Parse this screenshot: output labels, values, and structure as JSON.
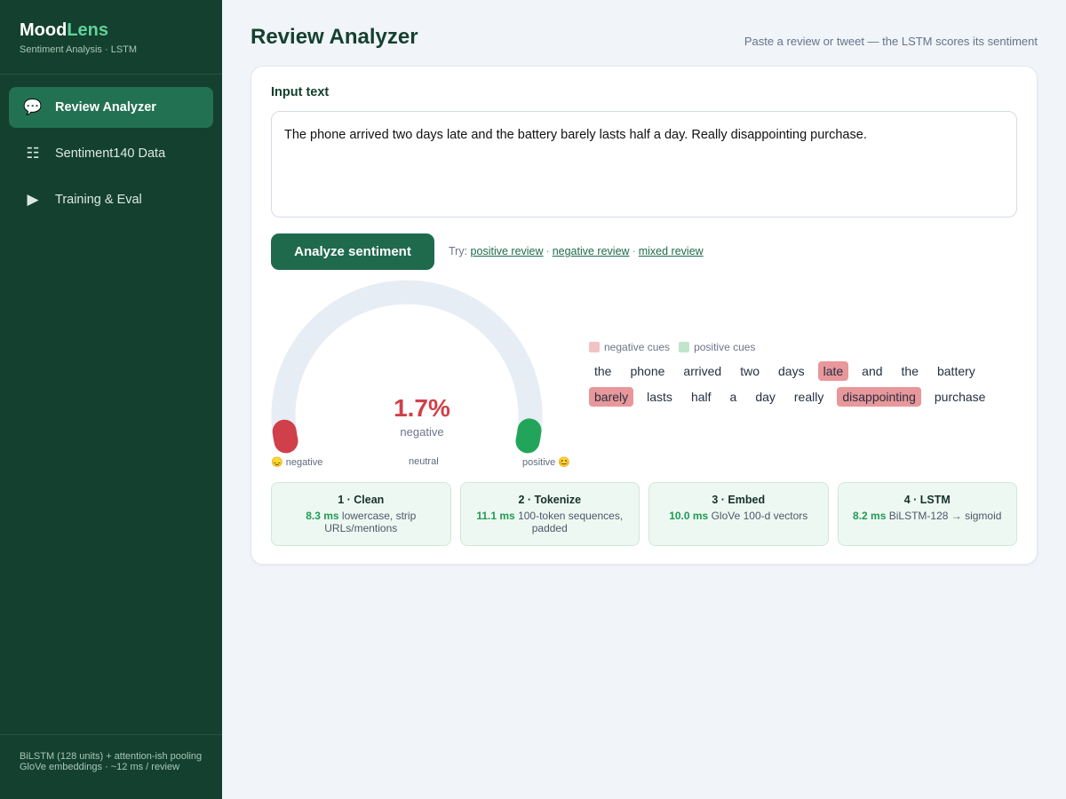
{
  "brand": {
    "title_a": "Mood",
    "title_b": "Lens",
    "subtitle": "Sentiment Analysis · LSTM"
  },
  "nav": [
    {
      "label": "Review Analyzer",
      "icon": "chat-bubble-icon",
      "active": true
    },
    {
      "label": "Sentiment140 Data",
      "icon": "table-list-icon",
      "active": false
    },
    {
      "label": "Training & Eval",
      "icon": "play-icon",
      "active": false
    }
  ],
  "footer": {
    "line1": "BiLSTM (128 units) + attention-ish pooling",
    "line2": "GloVe embeddings · ~12 ms / review"
  },
  "header": {
    "title": "Review Analyzer",
    "hint": "Paste a review or tweet — the LSTM scores its sentiment"
  },
  "input": {
    "label": "Input text",
    "value": "The phone arrived two days late and the battery barely lasts half a day. Really disappointing purchase."
  },
  "actions": {
    "analyze_label": "Analyze sentiment",
    "try_prefix": "Try:",
    "examples": [
      "positive review",
      "negative review",
      "mixed review"
    ]
  },
  "gauge": {
    "value": "1.7%",
    "score": 0.017,
    "label": "negative",
    "min_label": "😞 negative",
    "mid_label": "neutral",
    "max_label": "positive 😊",
    "neg_color": "#d0404a",
    "pos_color": "#22a55a",
    "track_color": "#e7edf4"
  },
  "cues": {
    "neg_label": "negative cues",
    "pos_label": "positive cues",
    "tokens": [
      {
        "text": "the",
        "type": "none"
      },
      {
        "text": "phone",
        "type": "none"
      },
      {
        "text": "arrived",
        "type": "none"
      },
      {
        "text": "two",
        "type": "none"
      },
      {
        "text": "days",
        "type": "none"
      },
      {
        "text": "late",
        "type": "neg"
      },
      {
        "text": "and",
        "type": "none"
      },
      {
        "text": "the",
        "type": "none"
      },
      {
        "text": "battery",
        "type": "none"
      },
      {
        "text": "barely",
        "type": "neg"
      },
      {
        "text": "lasts",
        "type": "none"
      },
      {
        "text": "half",
        "type": "none"
      },
      {
        "text": "a",
        "type": "none"
      },
      {
        "text": "day",
        "type": "none"
      },
      {
        "text": "really",
        "type": "none"
      },
      {
        "text": "disappointing",
        "type": "neg"
      },
      {
        "text": "purchase",
        "type": "none"
      }
    ]
  },
  "pipeline": [
    {
      "title": "1 · Clean",
      "ms": "8.3 ms",
      "desc": "lowercase, strip URLs/mentions"
    },
    {
      "title": "2 · Tokenize",
      "ms": "11.1 ms",
      "desc": "100-token sequences, padded"
    },
    {
      "title": "3 · Embed",
      "ms": "10.0 ms",
      "desc": "GloVe 100-d vectors"
    },
    {
      "title": "4 · LSTM",
      "ms": "8.2 ms",
      "desc": "BiLSTM-128 → sigmoid"
    }
  ]
}
